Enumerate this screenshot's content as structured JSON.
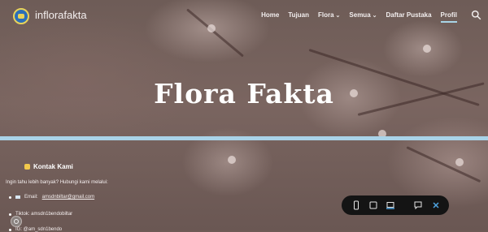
{
  "site": {
    "name": "inflorafakta"
  },
  "nav": {
    "items": [
      {
        "label": "Home",
        "dropdown": false
      },
      {
        "label": "Tujuan",
        "dropdown": false
      },
      {
        "label": "Flora",
        "dropdown": true
      },
      {
        "label": "Semua",
        "dropdown": true
      },
      {
        "label": "Daftar Pustaka",
        "dropdown": false
      },
      {
        "label": "Profil",
        "dropdown": false,
        "active": true
      }
    ],
    "chevron": "⌄",
    "active_color": "#a8d4e6"
  },
  "hero": {
    "title": "Flora Fakta"
  },
  "contact": {
    "heading": "Kontak Kami",
    "intro": "Ingin tahu lebih banyak? Hubungi kami melalui:",
    "email_label": "Email:",
    "email_value": "amsdnbiltar@gmail.com",
    "tiktok_label": "Tiktok: amsdn1bendobiltar",
    "ig_label": "IG: @am_sdn1bendo"
  },
  "toolbar": {
    "icons": [
      "phone-icon",
      "tablet-icon",
      "laptop-icon",
      "comment-icon",
      "close-icon"
    ],
    "accent": "#4fa3e0"
  },
  "colors": {
    "divider": "#a9d3e8",
    "toolbar_bg": "#141414"
  }
}
